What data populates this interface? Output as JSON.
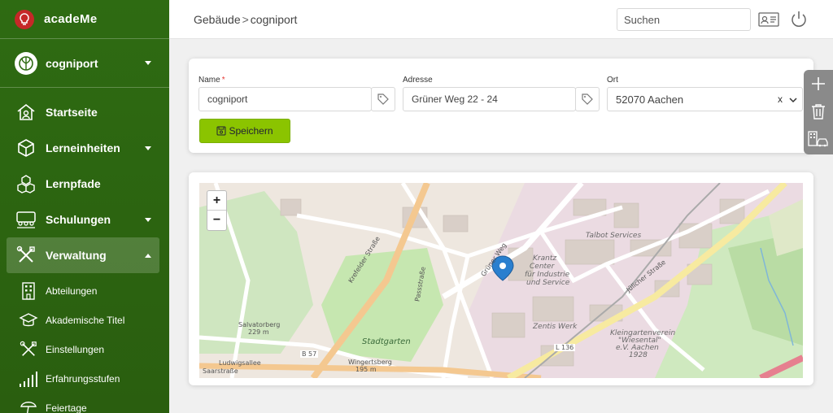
{
  "app": {
    "name": "acadeMe"
  },
  "tenant": {
    "name": "cogniport"
  },
  "nav": [
    {
      "label": "Startseite",
      "icon": "home-icon"
    },
    {
      "label": "Lerneinheiten",
      "icon": "cube-icon"
    },
    {
      "label": "Lernpfade",
      "icon": "cubes-icon"
    },
    {
      "label": "Schulungen",
      "icon": "classroom-icon"
    },
    {
      "label": "Verwaltung",
      "icon": "tools-icon"
    }
  ],
  "subnav": [
    {
      "label": "Abteilungen",
      "icon": "building-icon"
    },
    {
      "label": "Akademische Titel",
      "icon": "graduation-cap-icon"
    },
    {
      "label": "Einstellungen",
      "icon": "tools-icon"
    },
    {
      "label": "Erfahrungsstufen",
      "icon": "bars-icon"
    },
    {
      "label": "Feiertage",
      "icon": "beach-icon"
    }
  ],
  "header": {
    "breadcrumb": [
      "Gebäude",
      "cogniport"
    ],
    "search_placeholder": "Suchen"
  },
  "form": {
    "name_label": "Name",
    "name_value": "cogniport",
    "address_label": "Adresse",
    "address_value": "Grüner Weg 22 - 24",
    "city_label": "Ort",
    "city_value": "52070 Aachen",
    "clear_label": "x",
    "save_label": "Speichern"
  },
  "map": {
    "zoom_in": "+",
    "zoom_out": "−",
    "labels": {
      "talbot": "Talbot Services",
      "krantz": "Krantz",
      "krantz_center": "Center",
      "krantz_industrie": "für Industrie",
      "krantz_service": "und Service",
      "zentis": "Zentis Werk",
      "kleingarten1": "Kleingartenverein",
      "kleingarten2": "\"Wiesental\"",
      "kleingarten3": "e.V. Aachen",
      "kleingarten4": "1928",
      "stadtgarten": "Stadtgarten",
      "wingertsberg": "Wingertsberg",
      "wingertsberg_h": "195 m",
      "salvatorberg": "Salvatorberg",
      "salvatorberg_h": "229 m",
      "ludwigsallee": "Ludwigsallee",
      "saarstrasse": "Saarstraße",
      "krefelder": "Krefelder Straße",
      "juelicher": "Jülicher Straße",
      "gruener": "Grüner Weg",
      "b57": "B 57",
      "l136": "L 136",
      "passstrasse": "Passstraße"
    }
  },
  "colors": {
    "sidebar": "#2e6b12",
    "accent": "#8bc400",
    "logo": "#c62828",
    "pin": "#2a7fcf"
  }
}
